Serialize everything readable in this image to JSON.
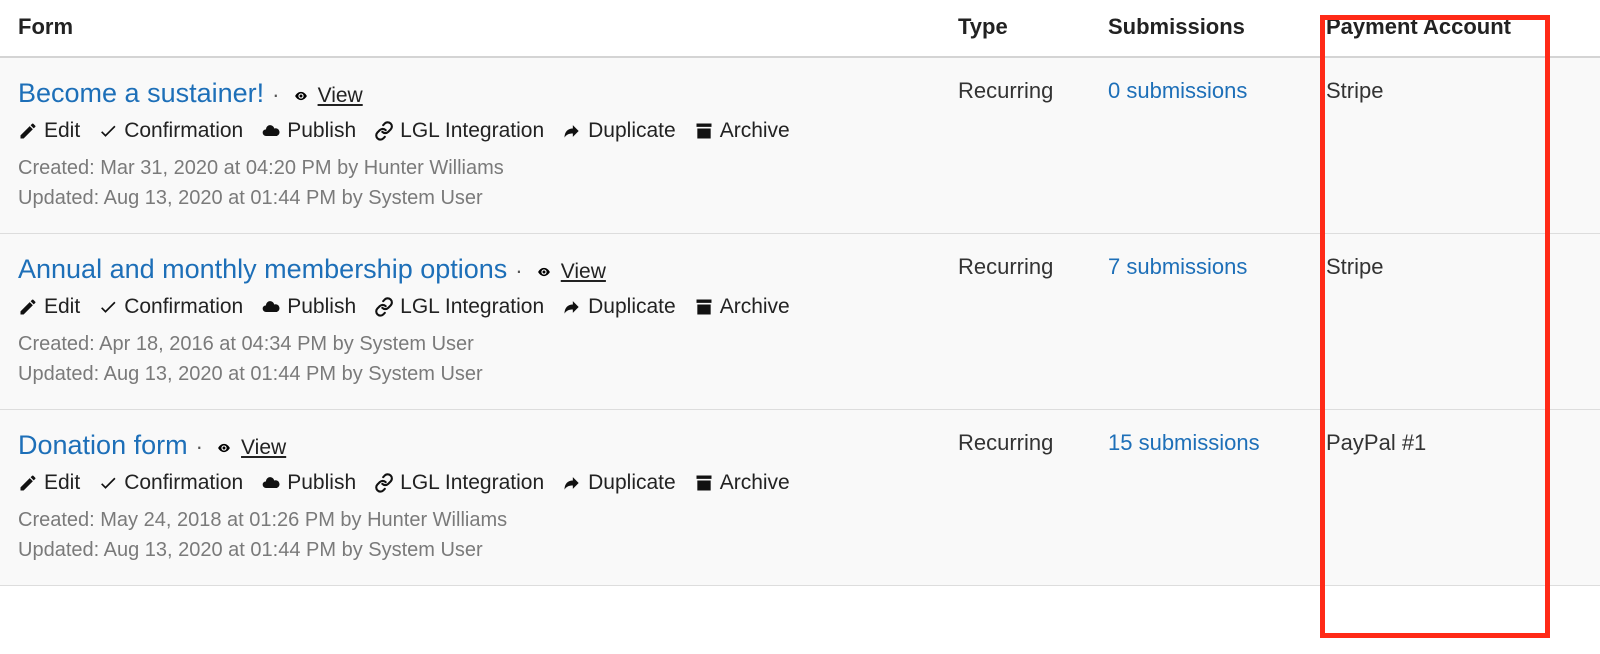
{
  "columns": {
    "form": "Form",
    "type": "Type",
    "submissions": "Submissions",
    "payment_account": "Payment Account"
  },
  "action_labels": {
    "view": "View",
    "edit": "Edit",
    "confirmation": "Confirmation",
    "publish": "Publish",
    "lgl_integration": "LGL Integration",
    "duplicate": "Duplicate",
    "archive": "Archive"
  },
  "rows": [
    {
      "title": "Become a sustainer!",
      "type": "Recurring",
      "submissions": "0 submissions",
      "payment_account": "Stripe",
      "created": "Created: Mar 31, 2020 at 04:20 PM by Hunter Williams",
      "updated": "Updated: Aug 13, 2020 at 01:44 PM by System User"
    },
    {
      "title": "Annual and monthly membership options",
      "type": "Recurring",
      "submissions": "7 submissions",
      "payment_account": "Stripe",
      "created": "Created: Apr 18, 2016 at 04:34 PM by System User",
      "updated": "Updated: Aug 13, 2020 at 01:44 PM by System User"
    },
    {
      "title": "Donation form",
      "type": "Recurring",
      "submissions": "15 submissions",
      "payment_account": "PayPal #1",
      "created": "Created: May 24, 2018 at 01:26 PM by Hunter Williams",
      "updated": "Updated: Aug 13, 2020 at 01:44 PM by System User"
    }
  ]
}
